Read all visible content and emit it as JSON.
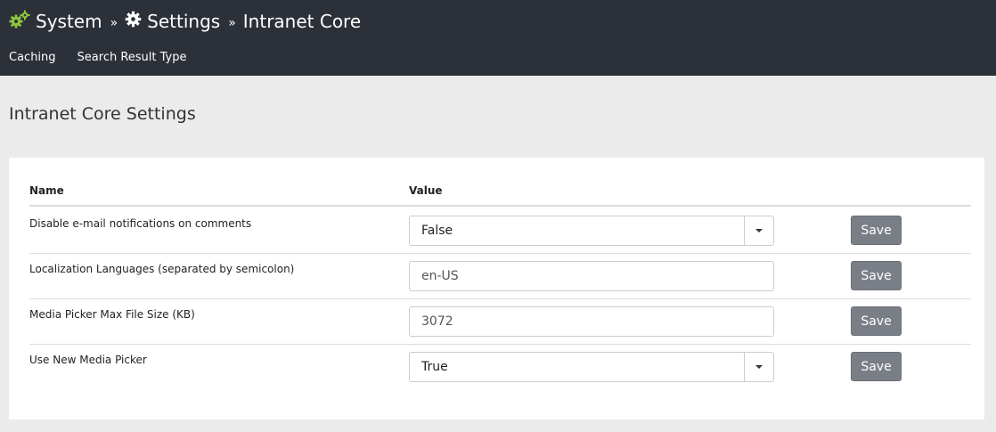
{
  "header": {
    "breadcrumb": [
      {
        "label": "System",
        "icon": "gears-icon",
        "icon_color": "#8cc63f"
      },
      {
        "label": "Settings",
        "icon": "gear-icon",
        "icon_color": "#ffffff"
      },
      {
        "label": "Intranet Core"
      }
    ],
    "separator": "»",
    "subnav": [
      "Caching",
      "Search Result Type"
    ]
  },
  "main": {
    "title": "Intranet Core Settings",
    "table": {
      "columns": {
        "name": "Name",
        "value": "Value"
      },
      "rows": [
        {
          "name": "Disable e-mail notifications on comments",
          "type": "select",
          "value": "False",
          "action": "Save"
        },
        {
          "name": "Localization Languages (separated by semicolon)",
          "type": "input",
          "value": "en-US",
          "action": "Save"
        },
        {
          "name": "Media Picker Max File Size (KB)",
          "type": "input",
          "value": "3072",
          "action": "Save"
        },
        {
          "name": "Use New Media Picker",
          "type": "select",
          "value": "True",
          "action": "Save"
        }
      ]
    }
  },
  "colors": {
    "topbar": "#2c3038",
    "accent_green": "#8cc63f",
    "save_button": "#7a7f87",
    "page_background": "#ebebeb"
  }
}
